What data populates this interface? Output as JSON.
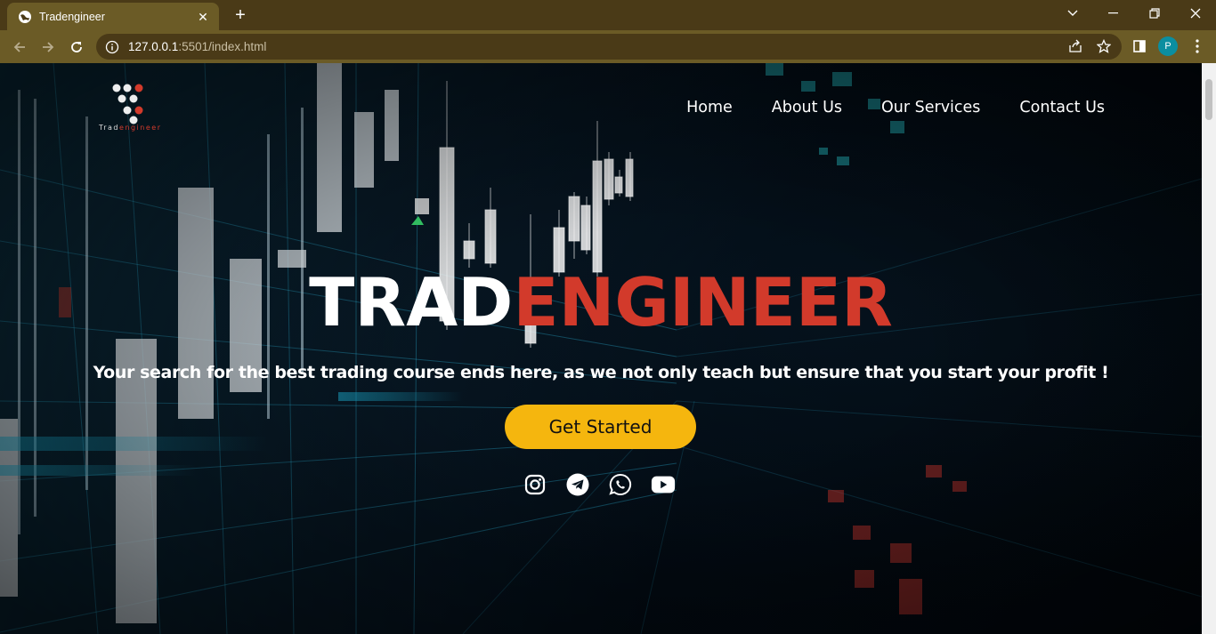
{
  "browser": {
    "tab_title": "Tradengineer",
    "url_host": "127.0.0.1",
    "url_path": ":5501/index.html",
    "profile_initial": "P"
  },
  "site": {
    "logo_text_light": "Trad",
    "logo_text_accent": "engineer",
    "nav": [
      "Home",
      "About Us",
      "Our Services",
      "Contact Us"
    ],
    "hero_title_white": "TRAD",
    "hero_title_red": "ENGINEER",
    "tagline": "Your search for the best trading course ends here, as we not only teach but ensure that you start your profit !",
    "cta_label": "Get Started",
    "socials": [
      "instagram-icon",
      "telegram-icon",
      "whatsapp-icon",
      "youtube-icon"
    ]
  },
  "colors": {
    "accent_red": "#d23a2b",
    "cta_yellow": "#f5b60e",
    "chrome_bg": "#4a3a17",
    "chrome_toolbar": "#6b5b26"
  }
}
